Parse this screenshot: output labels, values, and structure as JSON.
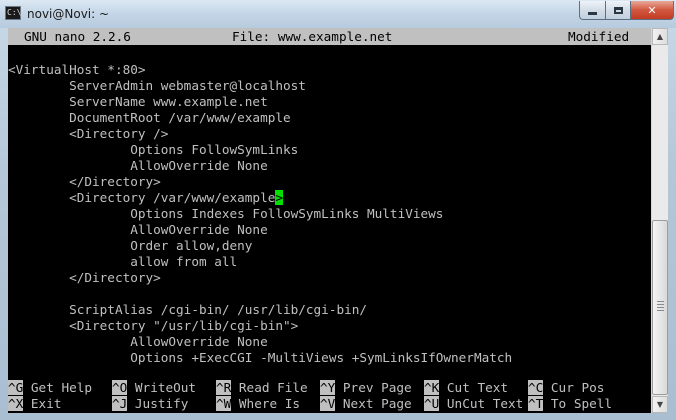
{
  "window": {
    "title": "novi@Novi: ~",
    "icon": "terminal-icon",
    "controls": {
      "minimize": "minimize-icon",
      "maximize": "maximize-icon",
      "close_label": "✕"
    }
  },
  "nano": {
    "version_label": "GNU nano 2.2.6",
    "file_label": "File: www.example.net",
    "status": "Modified"
  },
  "editor": {
    "lines": [
      "<VirtualHost *:80>",
      "        ServerAdmin webmaster@localhost",
      "        ServerName www.example.net",
      "        DocumentRoot /var/www/example",
      "        <Directory />",
      "                Options FollowSymLinks",
      "                AllowOverride None",
      "        </Directory>",
      "        <Directory /var/www/example",
      "                Options Indexes FollowSymLinks MultiViews",
      "                AllowOverride None",
      "                Order allow,deny",
      "                allow from all",
      "        </Directory>",
      "",
      "        ScriptAlias /cgi-bin/ /usr/lib/cgi-bin/",
      "        <Directory \"/usr/lib/cgi-bin\">",
      "                AllowOverride None",
      "                Options +ExecCGI -MultiViews +SymLinksIfOwnerMatch"
    ],
    "cursor_char": ">",
    "cursor_color": "#00e000"
  },
  "shortcuts": {
    "row1": [
      {
        "key": "^G",
        "label": " Get Help  "
      },
      {
        "key": "^O",
        "label": " WriteOut  "
      },
      {
        "key": "^R",
        "label": " Read File "
      },
      {
        "key": "^Y",
        "label": " Prev Page "
      },
      {
        "key": "^K",
        "label": " Cut Text  "
      },
      {
        "key": "^C",
        "label": " Cur Pos"
      }
    ],
    "row2": [
      {
        "key": "^X",
        "label": " Exit      "
      },
      {
        "key": "^J",
        "label": " Justify   "
      },
      {
        "key": "^W",
        "label": " Where Is  "
      },
      {
        "key": "^V",
        "label": " Next Page "
      },
      {
        "key": "^U",
        "label": " UnCut Text"
      },
      {
        "key": "^T",
        "label": " To Spell"
      }
    ]
  },
  "scrollbar": {
    "up_icon": "arrow-up-icon",
    "down_icon": "arrow-down-icon"
  },
  "colors": {
    "terminal_bg": "#000000",
    "terminal_fg": "#c0c0c0",
    "header_bg": "#c0c0c0",
    "cursor": "#00e000"
  }
}
